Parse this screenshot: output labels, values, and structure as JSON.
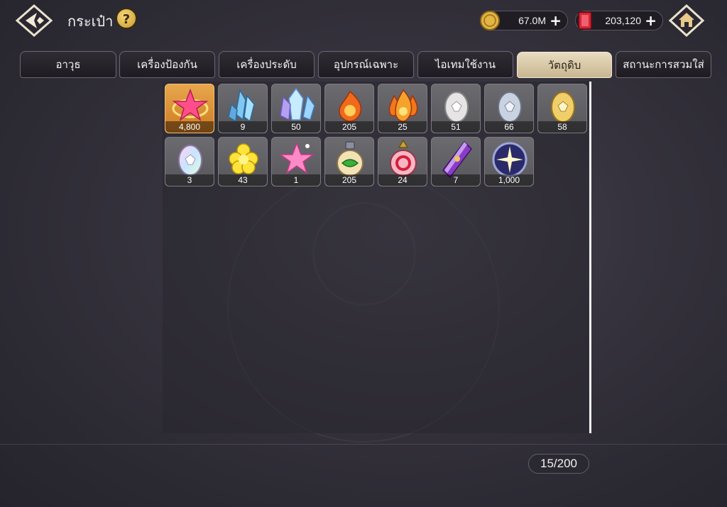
{
  "header": {
    "title": "กระเป๋า",
    "help_label": "?",
    "gold": {
      "value": "67.0M",
      "plus": "+"
    },
    "gems": {
      "value": "203,120",
      "plus": "+"
    }
  },
  "tabs": [
    {
      "label": "อาวุธ",
      "active": false
    },
    {
      "label": "เครื่องป้องกัน",
      "active": false
    },
    {
      "label": "เครื่องประดับ",
      "active": false
    },
    {
      "label": "อุปกรณ์เฉพาะ",
      "active": false
    },
    {
      "label": "ไอเทมใช้งาน",
      "active": false
    },
    {
      "label": "วัตถุดิบ",
      "active": true
    },
    {
      "label": "สถานะการสวมใส่",
      "active": false
    }
  ],
  "items": [
    {
      "icon": "pink-star-crystal-icon",
      "count": "4,800",
      "frame": "orange"
    },
    {
      "icon": "blue-crystal-cluster-icon",
      "count": "9",
      "frame": "gray"
    },
    {
      "icon": "large-crystal-cluster-icon",
      "count": "50",
      "frame": "gray"
    },
    {
      "icon": "fire-orb-icon",
      "count": "205",
      "frame": "gray"
    },
    {
      "icon": "fire-triple-orb-icon",
      "count": "25",
      "frame": "gray"
    },
    {
      "icon": "white-egg-icon",
      "count": "51",
      "frame": "gray"
    },
    {
      "icon": "silver-egg-icon",
      "count": "66",
      "frame": "gray"
    },
    {
      "icon": "gold-egg-icon",
      "count": "58",
      "frame": "gray"
    },
    {
      "icon": "rainbow-egg-icon",
      "count": "3",
      "frame": "gray"
    },
    {
      "icon": "yellow-flower-icon",
      "count": "43",
      "frame": "gray"
    },
    {
      "icon": "pink-star-icon",
      "count": "1",
      "frame": "gray"
    },
    {
      "icon": "green-potion-icon",
      "count": "205",
      "frame": "gray"
    },
    {
      "icon": "red-potion-icon",
      "count": "24",
      "frame": "gray"
    },
    {
      "icon": "purple-crystal-shard-icon",
      "count": "7",
      "frame": "gray"
    },
    {
      "icon": "starlight-orb-icon",
      "count": "1,000",
      "frame": "gray"
    }
  ],
  "capacity": "15/200"
}
